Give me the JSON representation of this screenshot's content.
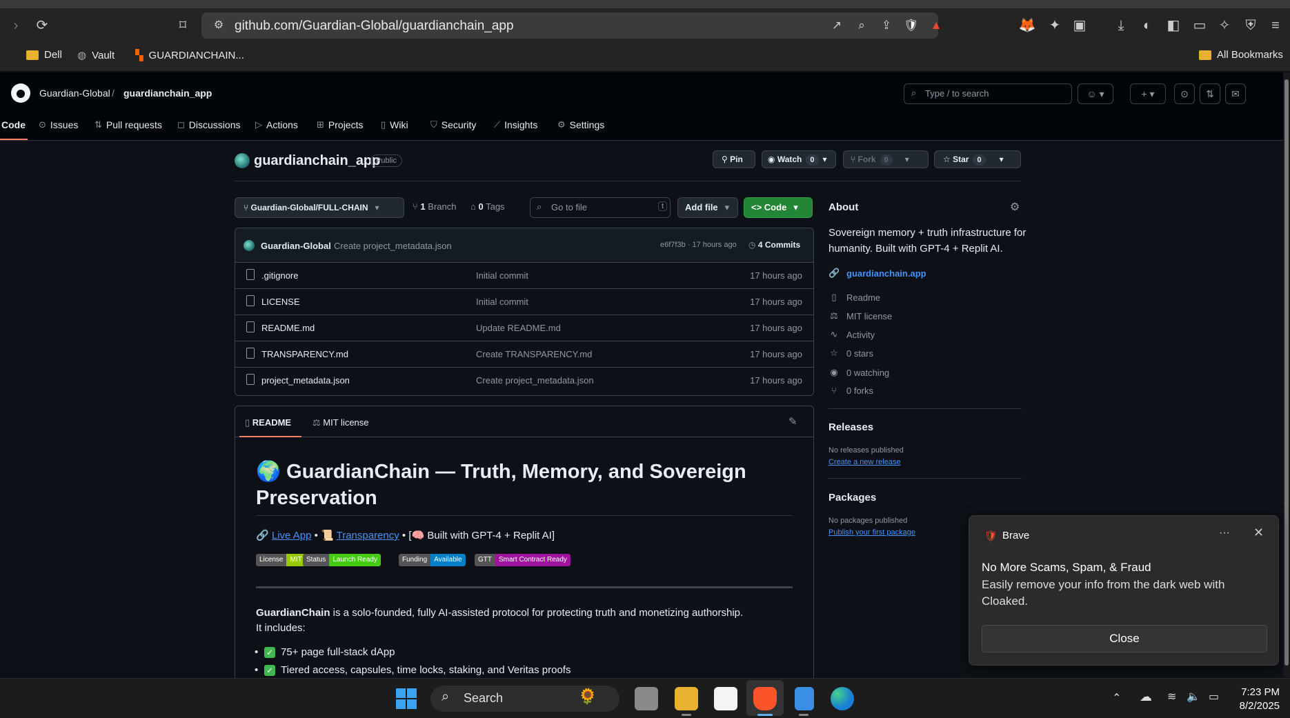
{
  "browser": {
    "url": "github.com/Guardian-Global/guardianchain_app",
    "bookmarks": [
      "Dell",
      "Vault",
      "GUARDIANCHAIN..."
    ],
    "all_bookmarks": "All Bookmarks"
  },
  "header": {
    "owner": "Guardian-Global",
    "separator": "/",
    "repo": "guardianchain_app",
    "search_placeholder": "Type / to search",
    "slash_key": "/"
  },
  "nav": {
    "tabs": [
      {
        "label": "Code",
        "icon": "code-icon"
      },
      {
        "label": "Issues",
        "icon": "issue-icon"
      },
      {
        "label": "Pull requests",
        "icon": "pull-request-icon"
      },
      {
        "label": "Discussions",
        "icon": "discussion-icon"
      },
      {
        "label": "Actions",
        "icon": "play-icon"
      },
      {
        "label": "Projects",
        "icon": "table-icon"
      },
      {
        "label": "Wiki",
        "icon": "book-icon"
      },
      {
        "label": "Security",
        "icon": "shield-icon"
      },
      {
        "label": "Insights",
        "icon": "graph-icon"
      },
      {
        "label": "Settings",
        "icon": "gear-icon"
      }
    ]
  },
  "repo": {
    "title": "guardianchain_app",
    "visibility": "Public",
    "pin_label": "Pin",
    "watch_label": "Watch",
    "watch_count": "0",
    "fork_label": "Fork",
    "fork_count": "0",
    "star_label": "Star",
    "star_count": "0"
  },
  "toolbar": {
    "branch": "Guardian-Global/FULL-CHAIN",
    "branch_count": "1",
    "branch_label": "Branch",
    "tags_count": "0",
    "tags_label": "Tags",
    "goto_placeholder": "Go to file",
    "goto_key": "t",
    "add_file_label": "Add file",
    "code_label": "Code"
  },
  "latest_commit": {
    "author": "Guardian-Global",
    "message": "Create project_metadata.json",
    "hash_time": "e6f7f3b · 17 hours ago",
    "commits_count": "4",
    "commits_label": "Commits"
  },
  "files": [
    {
      "name": ".gitignore",
      "message": "Initial commit",
      "time": "17 hours ago"
    },
    {
      "name": "LICENSE",
      "message": "Initial commit",
      "time": "17 hours ago"
    },
    {
      "name": "README.md",
      "message": "Update README.md",
      "time": "17 hours ago"
    },
    {
      "name": "TRANSPARENCY.md",
      "message": "Create TRANSPARENCY.md",
      "time": "17 hours ago"
    },
    {
      "name": "project_metadata.json",
      "message": "Create project_metadata.json",
      "time": "17 hours ago"
    }
  ],
  "readme": {
    "tab_readme": "README",
    "tab_license": "MIT license",
    "heading": "🌍 GuardianChain — Truth, Memory, and Sovereign Preservation",
    "link_live": "Live App",
    "link_transparency": "Transparency",
    "link_prefix_live": "🔗",
    "link_prefix_transparency": "📜",
    "sep1": " • ",
    "sep2": " • [",
    "built_with": "🧠 Built with GPT-4 + Replit AI]",
    "badges": [
      {
        "left": "License",
        "right": "MIT",
        "color": "#97ca00"
      },
      {
        "left": "Status",
        "right": "Launch Ready",
        "color": "#4c1"
      },
      {
        "left": "Funding",
        "right": "Available",
        "color": "#007ec6"
      },
      {
        "left": "GTT",
        "right": "Smart Contract Ready",
        "color": "#a0139f"
      }
    ],
    "desc_bold": "GuardianChain",
    "desc_rest": " is a solo-founded, fully AI-assisted protocol for protecting truth and monetizing authorship.",
    "desc_line2": "It includes:",
    "bullets": [
      "75+ page full-stack dApp",
      "Tiered access, capsules, time locks, staking, and Veritas proofs"
    ]
  },
  "about": {
    "heading": "About",
    "description": "Sovereign memory + truth infrastructure for humanity. Built with GPT-4 + Replit AI.",
    "website": "guardianchain.app",
    "items": [
      {
        "label": "Readme",
        "icon": "book-icon"
      },
      {
        "label": "MIT license",
        "icon": "scale-icon"
      },
      {
        "label": "Activity",
        "icon": "pulse-icon"
      },
      {
        "label": "0 stars",
        "icon": "star-icon"
      },
      {
        "label": "0 watching",
        "icon": "eye-icon"
      },
      {
        "label": "0 forks",
        "icon": "fork-icon"
      }
    ],
    "releases_heading": "Releases",
    "releases_none": "No releases published",
    "releases_link": "Create a new release",
    "packages_heading": "Packages",
    "packages_none": "No packages published",
    "packages_link": "Publish your first package"
  },
  "toast": {
    "app": "Brave",
    "title": "No More Scams, Spam, & Fraud",
    "body": "Easily remove your info from the dark web with Cloaked.",
    "close_label": "Close",
    "more": "···"
  },
  "taskbar": {
    "search_label": "Search",
    "time": "7:23 PM",
    "date": "8/2/2025"
  },
  "colors": {
    "accent_green": "#238636",
    "link_blue": "#4493f8",
    "tab_underline": "#f78166"
  }
}
